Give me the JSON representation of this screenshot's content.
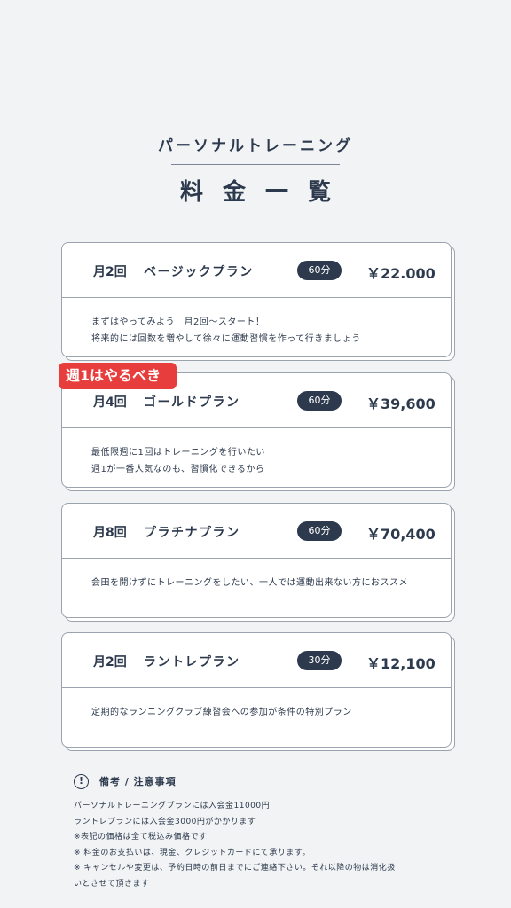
{
  "header": {
    "subtitle": "パーソナルトレーニング",
    "title": "料金一覧"
  },
  "ribbon": {
    "label": "週1はやるべき"
  },
  "plans": [
    {
      "freq": "月2回",
      "name": "ベージックプラン",
      "duration": "60分",
      "price": "￥22.000",
      "desc": [
        "まずはやってみよう　月2回〜スタート！",
        "将来的には回数を増やして徐々に運動習慣を作って行きましょう"
      ]
    },
    {
      "freq": "月4回",
      "name": "ゴールドプラン",
      "duration": "60分",
      "price": "￥39,600",
      "desc": [
        "最低限週に1回はトレーニングを行いたい",
        "週1が一番人気なのも、習慣化できるから"
      ]
    },
    {
      "freq": "月8回",
      "name": "プラチナプラン",
      "duration": "60分",
      "price": "￥70,400",
      "desc": [
        "会田を開けずにトレーニングをしたい、一人では運動出来ない方におススメ"
      ]
    },
    {
      "freq": "月2回",
      "name": "ラントレプラン",
      "duration": "30分",
      "price": "￥12,100",
      "desc": [
        "定期的なランニングクラブ練習会への参加が条件の特別プラン"
      ]
    }
  ],
  "notes": {
    "icon": "alert-icon",
    "icon_glyph": "!",
    "title": "備考 / 注意事項",
    "items": [
      "パーソナルトレーニングプランには入会金11000円",
      "ラントレプランには入会金3000円がかかります",
      "※表記の価格は全て税込み価格です",
      "※ 料金のお支払いは、現金、クレジットカードにて承ります。",
      "※ キャンセルや変更は、予約日時の前日までにご連絡下さい。それ以降の物は消化扱",
      "いとさせて頂きます"
    ]
  }
}
